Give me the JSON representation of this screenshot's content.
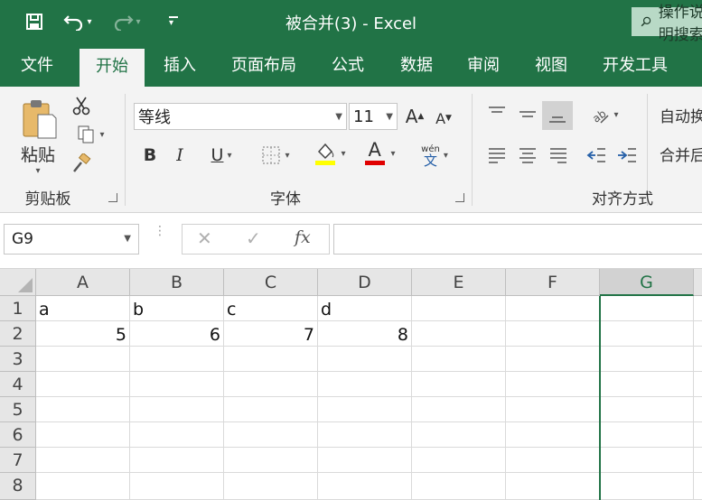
{
  "title_bar": {
    "title": "被合并(3)  -  Excel",
    "tell_me": "操作说明搜索"
  },
  "tabs": [
    "文件",
    "开始",
    "插入",
    "页面布局",
    "公式",
    "数据",
    "审阅",
    "视图",
    "开发工具"
  ],
  "active_tab": "开始",
  "ribbon": {
    "clipboard": {
      "paste_label": "粘贴",
      "group_label": "剪贴板"
    },
    "font": {
      "font_name": "等线",
      "font_size": "11",
      "bold": "B",
      "italic": "I",
      "underline": "U",
      "font_color_letter": "A",
      "phonetic_top": "wén",
      "phonetic_bottom": "文",
      "group_label": "字体",
      "fill_color": "#ffff00",
      "font_color": "#e00000"
    },
    "alignment": {
      "wrap_label": "自动换行",
      "merge_label": "合并后居中",
      "group_label": "对齐方式"
    }
  },
  "formula_bar": {
    "name_box": "G9",
    "fx": "fx",
    "formula": ""
  },
  "sheet": {
    "columns": [
      "A",
      "B",
      "C",
      "D",
      "E",
      "F",
      "G"
    ],
    "selected_column": "G",
    "rows": [
      "1",
      "2",
      "3",
      "4",
      "5",
      "6",
      "7",
      "8"
    ],
    "cells": {
      "A1": "a",
      "B1": "b",
      "C1": "c",
      "D1": "d",
      "A2": "5",
      "B2": "6",
      "C2": "7",
      "D2": "8"
    }
  },
  "colors": {
    "excel_green": "#217346",
    "ribbon_bg": "#f3f3f3"
  }
}
